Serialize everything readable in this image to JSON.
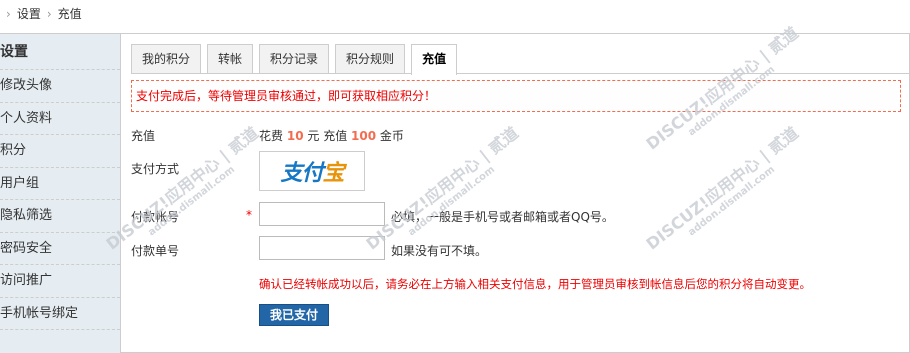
{
  "breadcrumb": {
    "items": [
      "设置",
      "充值"
    ]
  },
  "sidebar": {
    "title": "设置",
    "items": [
      {
        "label": "修改头像"
      },
      {
        "label": "个人资料"
      },
      {
        "label": "积分"
      },
      {
        "label": "用户组"
      },
      {
        "label": "隐私筛选"
      },
      {
        "label": "密码安全"
      },
      {
        "label": "访问推广"
      },
      {
        "label": "手机帐号绑定"
      }
    ]
  },
  "tabs": [
    {
      "label": "我的积分"
    },
    {
      "label": "转帐"
    },
    {
      "label": "积分记录"
    },
    {
      "label": "积分规则"
    },
    {
      "label": "充值",
      "active": true
    }
  ],
  "notice": "支付完成后，等待管理员审核通过，即可获取相应积分！",
  "recharge": {
    "label": "充值",
    "prefix": "花费",
    "amount": "10",
    "unit1": "元 充值",
    "coins": "100",
    "unit2": "金币"
  },
  "payment_method": {
    "label": "支付方式",
    "logo_text_a": "支付",
    "logo_text_b": "宝"
  },
  "account_field": {
    "label": "付款帐号",
    "required_mark": "*",
    "value": "",
    "hint": "必填，一般是手机号或者邮箱或者QQ号。"
  },
  "order_field": {
    "label": "付款单号",
    "value": "",
    "hint": "如果没有可不填。"
  },
  "confirm_text": "确认已经转帐成功以后，请务必在上方输入相关支付信息，用于管理员审核到帐信息后您的积分将自动变更。",
  "submit_label": "我已支付",
  "colors": {
    "accent": "#f26c4f",
    "sidebar_bg": "#e5edf2",
    "button_bg": "#2366a8",
    "alert": "#ee0000"
  },
  "watermark": {
    "brand": "DISCUZ!应用中心 | 贰道",
    "domain": "addon.dismall.com"
  }
}
